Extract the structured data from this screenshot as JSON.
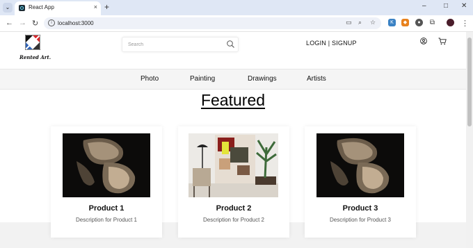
{
  "browser": {
    "tab_title": "React App",
    "tab_close": "×",
    "new_tab": "+",
    "url": "localhost:3000",
    "window_controls": {
      "minimize": "–",
      "maximize": "□",
      "close": "✕"
    }
  },
  "site": {
    "logo_text": "Rented Art.",
    "search_placeholder": "Search",
    "auth": {
      "login": "LOGIN",
      "separator": "|",
      "signup": "SIGNUP"
    }
  },
  "categories": [
    "Photo",
    "Painting",
    "Drawings",
    "Artists"
  ],
  "featured_heading": "Featured",
  "products": [
    {
      "title": "Product 1",
      "description": "Description for Product 1",
      "image": "dark-sculpture-art"
    },
    {
      "title": "Product 2",
      "description": "Description for Product 2",
      "image": "abstract-painting-room"
    },
    {
      "title": "Product 3",
      "description": "Description for Product 3",
      "image": "dark-sculpture-art"
    }
  ]
}
